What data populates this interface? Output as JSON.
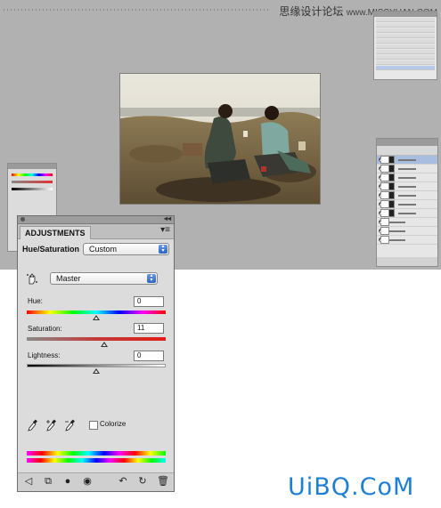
{
  "watermark": {
    "site_cn": "思缘设计论坛",
    "site_url": "www.MISSYUAN.COM"
  },
  "adjustments": {
    "tab_label": "ADJUSTMENTS",
    "preset_label": "Hue/Saturation",
    "preset_value": "Custom",
    "channel_value": "Master",
    "hue": {
      "label": "Hue:",
      "value": "0",
      "level": 0.5
    },
    "saturation": {
      "label": "Saturation:",
      "value": "11",
      "level": 0.555
    },
    "lightness": {
      "label": "Lightness:",
      "value": "0",
      "level": 0.5
    },
    "colorize_label": "Colorize",
    "colorize_checked": false
  },
  "logo": {
    "text": "UiBQ.CoM"
  },
  "icons": [
    "hand-target-icon",
    "eyedropper-icon",
    "eyedropper-plus-icon",
    "eyedropper-minus-icon",
    "back-arrow-icon",
    "expand-view-icon",
    "clip-layer-icon",
    "visibility-eye-icon",
    "view-previous-icon",
    "reset-icon",
    "trash-icon",
    "panel-menu-icon",
    "collapse-icon"
  ],
  "colors": {
    "workspace": "#b1b1b1",
    "panel": "#dcdcdc",
    "accent_blue": "#1e7fd6",
    "selection": "#a9bde0"
  }
}
